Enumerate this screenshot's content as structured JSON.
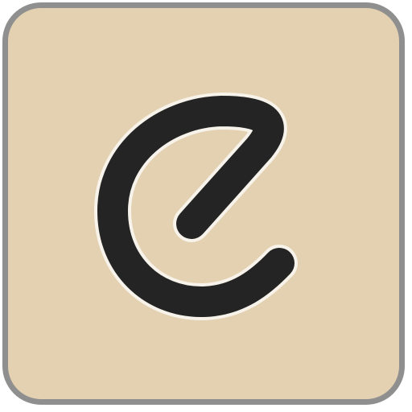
{
  "app_icon": {
    "icon_name": "letter-e-logo-icon",
    "colors": {
      "tile_background": "#e3d1b2",
      "tile_border": "#8f8f8f",
      "glyph_fill": "#242424",
      "glyph_outline": "#f7f3ea"
    }
  }
}
